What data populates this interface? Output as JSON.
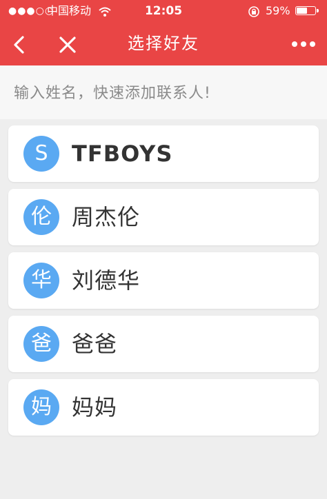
{
  "status_bar": {
    "signal": "●●●○○",
    "carrier": "中国移动",
    "wifi_icon": "wifi-icon",
    "time": "12:05",
    "rotation_lock_icon": "rotation-lock-icon",
    "battery_percent": "59%",
    "battery_level": 0.59
  },
  "nav": {
    "back_glyph": "‹",
    "close_glyph": "✕",
    "title": "选择好友",
    "more_glyph": "•••",
    "background_color": "#e94545"
  },
  "search": {
    "placeholder": "输入姓名，快速添加联系人!"
  },
  "contacts": [
    {
      "avatar": "S",
      "name": "TFBOYS"
    },
    {
      "avatar": "伦",
      "name": "周杰伦"
    },
    {
      "avatar": "华",
      "name": "刘德华"
    },
    {
      "avatar": "爸",
      "name": "爸爸"
    },
    {
      "avatar": "妈",
      "name": "妈妈"
    }
  ],
  "colors": {
    "accent": "#e94545",
    "avatar": "#5aa9f2"
  }
}
